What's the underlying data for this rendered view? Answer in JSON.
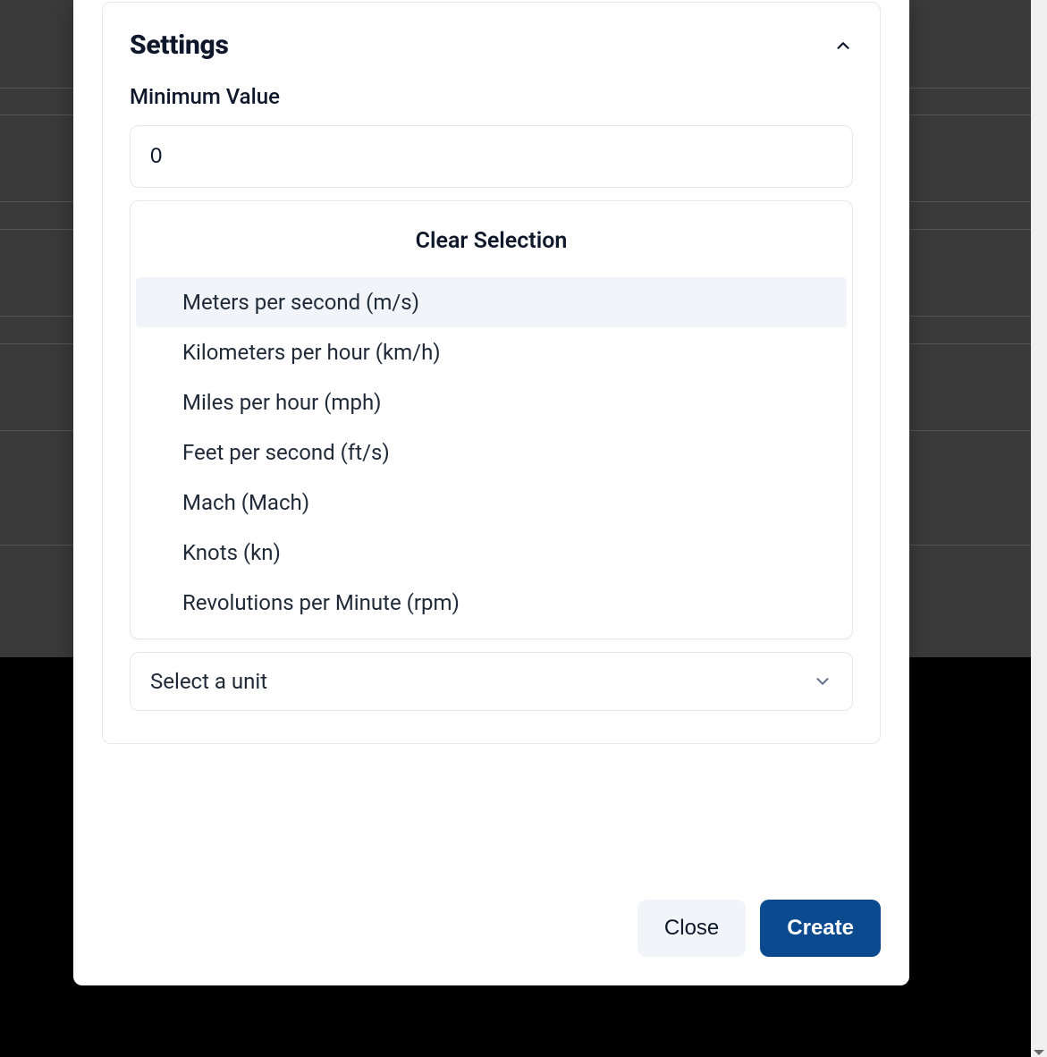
{
  "settings": {
    "title": "Settings",
    "minimum_value_label": "Minimum Value",
    "minimum_value": "0",
    "clear_selection_label": "Clear Selection",
    "unit_options": [
      "Meters per second (m/s)",
      "Kilometers per hour (km/h)",
      "Miles per hour (mph)",
      "Feet per second (ft/s)",
      "Mach (Mach)",
      "Knots (kn)",
      "Revolutions per Minute (rpm)"
    ],
    "highlighted_index": 0,
    "unit_select_placeholder": "Select a unit"
  },
  "footer": {
    "close_label": "Close",
    "create_label": "Create"
  }
}
